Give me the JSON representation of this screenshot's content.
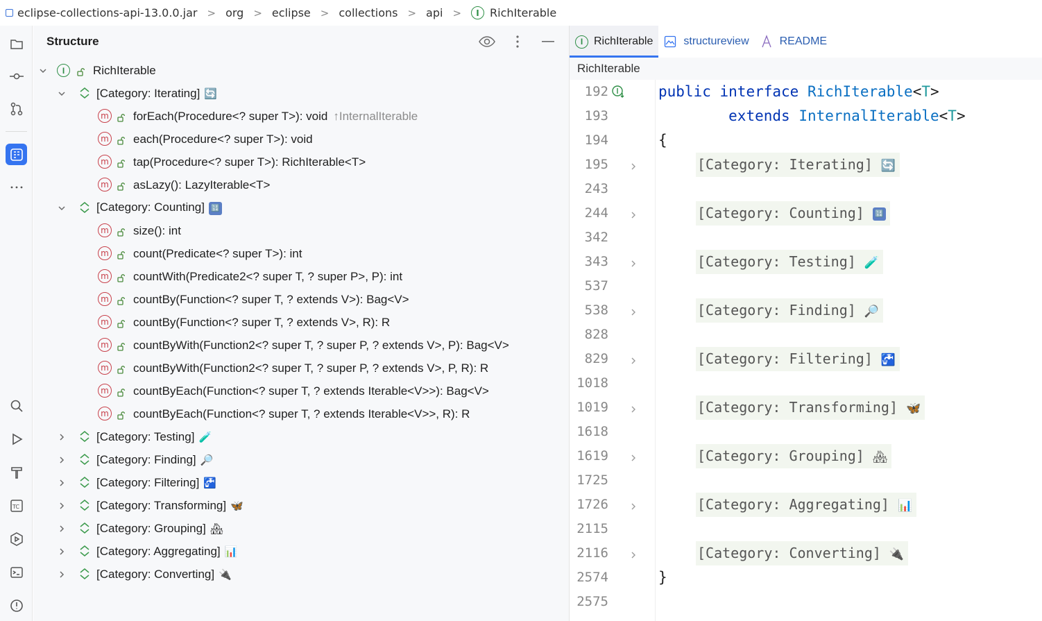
{
  "breadcrumb": {
    "items": [
      "eclipse-collections-api-13.0.0.jar",
      "org",
      "eclipse",
      "collections",
      "api",
      "RichIterable"
    ],
    "separator": ">"
  },
  "structure": {
    "title": "Structure",
    "root": "RichIterable",
    "rows": [
      {
        "label": "[Category: Iterating]",
        "emoji": "🔄"
      },
      {
        "label": "forEach(Procedure<? super T>): void",
        "hint": "↑InternalIterable"
      },
      {
        "label": "each(Procedure<? super T>): void"
      },
      {
        "label": "tap(Procedure<? super T>): RichIterable<T>"
      },
      {
        "label": "asLazy(): LazyIterable<T>"
      },
      {
        "label": "[Category: Counting]",
        "emoji": "🔢"
      },
      {
        "label": "size(): int"
      },
      {
        "label": "count(Predicate<? super T>): int"
      },
      {
        "label": "countWith(Predicate2<? super T, ? super P>, P): int"
      },
      {
        "label": "countBy(Function<? super T, ? extends V>): Bag<V>"
      },
      {
        "label": "countBy(Function<? super T, ? extends V>, R): R"
      },
      {
        "label": "countByWith(Function2<? super T, ? super P, ? extends V>, P): Bag<V>"
      },
      {
        "label": "countByWith(Function2<? super T, ? super P, ? extends V>, P, R): R"
      },
      {
        "label": "countByEach(Function<? super T, ? extends Iterable<V>>): Bag<V>"
      },
      {
        "label": "countByEach(Function<? super T, ? extends Iterable<V>>, R): R"
      },
      {
        "label": "[Category: Testing]",
        "emoji": "🧪"
      },
      {
        "label": "[Category: Finding]",
        "emoji": "🔎"
      },
      {
        "label": "[Category: Filtering]",
        "emoji": "🚰"
      },
      {
        "label": "[Category: Transforming]",
        "emoji": "🦋"
      },
      {
        "label": "[Category: Grouping]",
        "emoji": "🏘"
      },
      {
        "label": "[Category: Aggregating]",
        "emoji": "📊"
      },
      {
        "label": "[Category: Converting]",
        "emoji": "🔌"
      }
    ]
  },
  "editor": {
    "tabs": [
      "RichIterable",
      "structureview",
      "README"
    ],
    "breadcrumb": "RichIterable",
    "line_numbers": [
      "192",
      "193",
      "194",
      "195",
      "243",
      "244",
      "342",
      "343",
      "537",
      "538",
      "828",
      "829",
      "1018",
      "1019",
      "1618",
      "1619",
      "1725",
      "1726",
      "2115",
      "2116",
      "2574",
      "2575"
    ],
    "code": {
      "kw_public": "public",
      "kw_interface": "interface",
      "name": "RichIterable",
      "tp_open": "<",
      "tp_T": "T",
      "tp_close": ">",
      "kw_extends": "extends",
      "parent": "InternalIterable",
      "open_brace": "{",
      "close_brace": "}"
    },
    "folds": [
      {
        "label": "[Category: Iterating]",
        "emoji": "🔄"
      },
      {
        "label": "[Category: Counting]",
        "emoji": "🔢"
      },
      {
        "label": "[Category: Testing]",
        "emoji": "🧪"
      },
      {
        "label": "[Category: Finding]",
        "emoji": "🔎"
      },
      {
        "label": "[Category: Filtering]",
        "emoji": "🚰"
      },
      {
        "label": "[Category: Transforming]",
        "emoji": "🦋"
      },
      {
        "label": "[Category: Grouping]",
        "emoji": "🏘"
      },
      {
        "label": "[Category: Aggregating]",
        "emoji": "📊"
      },
      {
        "label": "[Category: Converting]",
        "emoji": "🔌"
      }
    ]
  },
  "colors": {
    "accent": "#3574f0",
    "interface": "#2f8f47",
    "method": "#c8414b",
    "keyword": "#0033b3"
  }
}
